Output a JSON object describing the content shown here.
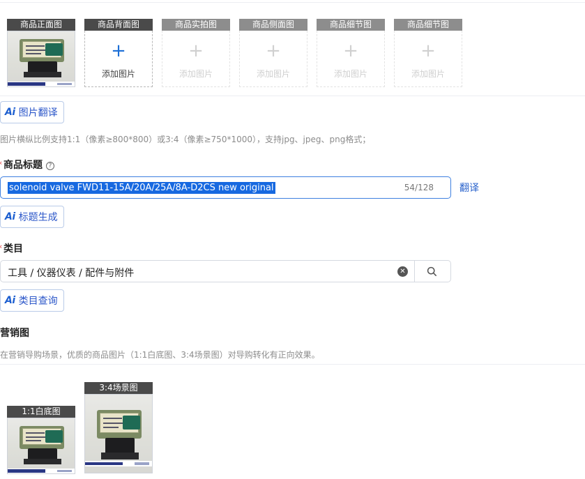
{
  "gallery": {
    "slots": [
      {
        "label": "商品正面图",
        "filled": true
      },
      {
        "label": "商品背面图",
        "add_text": "添加图片",
        "plus": "+"
      },
      {
        "label": "商品实拍图",
        "add_text": "添加图片",
        "plus": "+"
      },
      {
        "label": "商品侧面图",
        "add_text": "添加图片",
        "plus": "+"
      },
      {
        "label": "商品细节图",
        "add_text": "添加图片",
        "plus": "+"
      },
      {
        "label": "商品细节图",
        "add_text": "添加图片",
        "plus": "+"
      }
    ]
  },
  "image_translate": {
    "icon": "Ai",
    "label": "图片翻译"
  },
  "image_hint": "图片横纵比例支持1:1（像素≥800*800）或3:4（像素≥750*1000），支持jpg、jpeg、png格式；",
  "title_field": {
    "required_mark": "*",
    "label": "商品标题",
    "help": "?",
    "value": "solenoid valve FWD11-15A/20A/25A/8A-D2CS new original",
    "count": "54/128",
    "translate": "翻译"
  },
  "title_generate": {
    "icon": "Ai",
    "label": "标题生成"
  },
  "category_field": {
    "required_mark": "*",
    "label": "类目",
    "value": "工具 / 仪器仪表 / 配件与附件",
    "clear": "✕"
  },
  "category_query": {
    "icon": "Ai",
    "label": "类目查询"
  },
  "marketing": {
    "label": "营销图",
    "hint": "在营销导购场景，优质的商品图片（1:1白底图、3:4场景图）对导购转化有正向效果。",
    "slots": [
      {
        "label": "1:1白底图"
      },
      {
        "label": "3:4场景图"
      }
    ]
  }
}
